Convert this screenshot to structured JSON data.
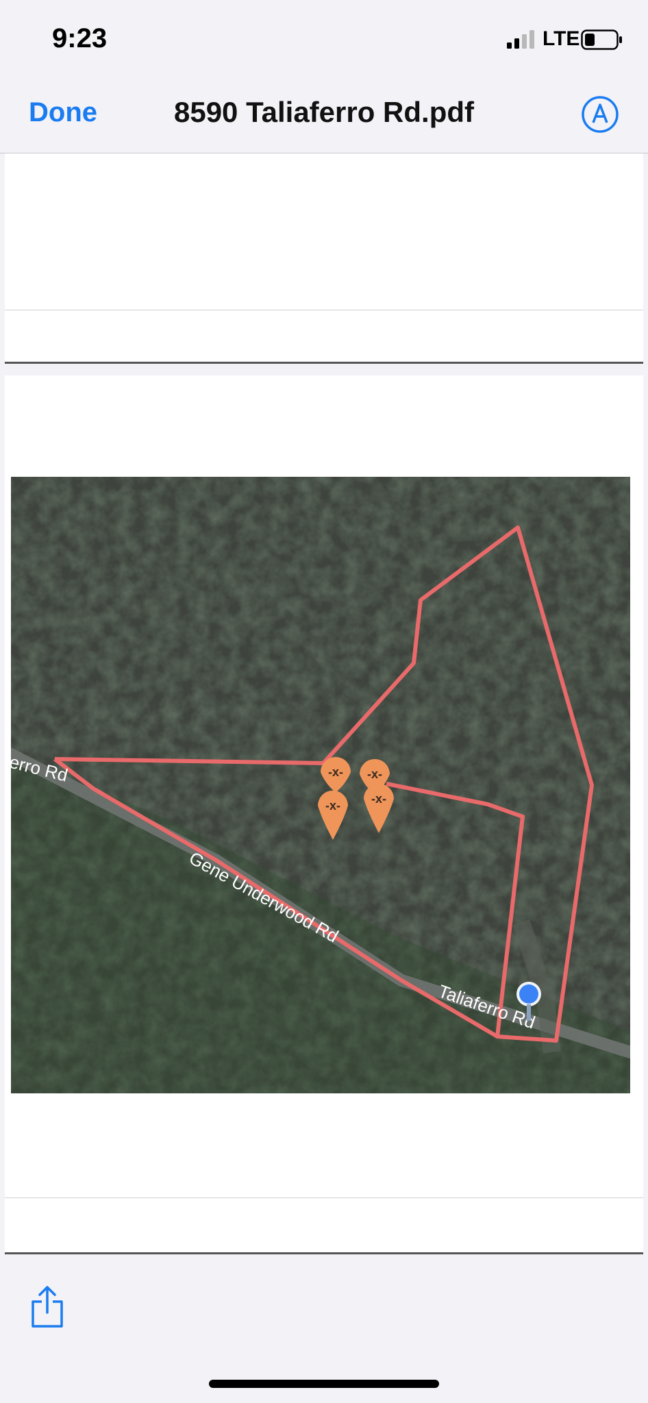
{
  "status": {
    "time": "9:23",
    "network": "LTE"
  },
  "nav": {
    "done_label": "Done",
    "title": "8590 Taliaferro Rd.pdf"
  },
  "map": {
    "roads": {
      "road_left": "erro Rd",
      "road_main": "Gene Underwood Rd",
      "road_right": "Taliaferro Rd"
    },
    "markers": [
      "-x-",
      "-x-",
      "-x-",
      "-x-"
    ],
    "colors": {
      "boundary": "#e86a6a",
      "marker": "#f0955a",
      "location": "#3b82f6"
    }
  },
  "toolbar": {
    "share_icon": "share-icon"
  }
}
